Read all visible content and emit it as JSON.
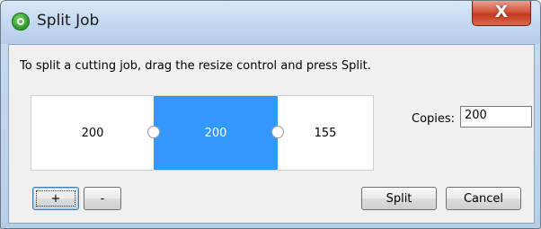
{
  "window": {
    "title": "Split Job",
    "close_label": "X"
  },
  "dialog": {
    "instruction": "To split a cutting job, drag the resize control and press Split.",
    "segments": [
      {
        "value": "200",
        "selected": false
      },
      {
        "value": "200",
        "selected": true
      },
      {
        "value": "155",
        "selected": false
      }
    ],
    "copies_label": "Copies:",
    "copies_value": "200",
    "add_button": "+",
    "remove_button": "-",
    "split_button": "Split",
    "cancel_button": "Cancel"
  },
  "colors": {
    "selected_segment": "#3399ff",
    "close_button": "#c2391f",
    "app_icon": "#2f9a2a"
  },
  "icons": {
    "app": "split-job-app-icon",
    "close": "close-icon"
  }
}
